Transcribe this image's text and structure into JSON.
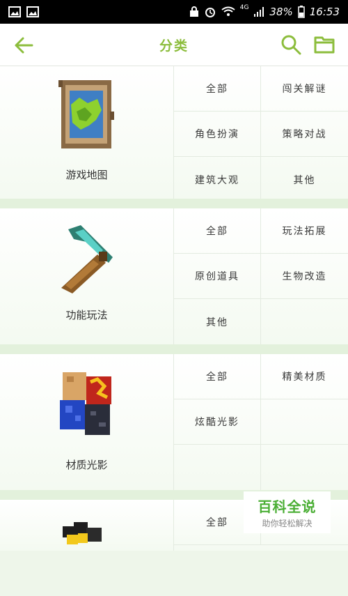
{
  "status_bar": {
    "network": "4G",
    "battery": "38%",
    "time": "16:53"
  },
  "app_bar": {
    "title": "分类"
  },
  "colors": {
    "accent": "#8cbd3c",
    "section_gap": "#e3f1dc"
  },
  "sections": [
    {
      "label": "游戏地图",
      "icon": "map-icon",
      "items": [
        "全部",
        "闯关解谜",
        "角色扮演",
        "策略对战",
        "建筑大观",
        "其他"
      ]
    },
    {
      "label": "功能玩法",
      "icon": "pickaxe-icon",
      "items": [
        "全部",
        "玩法拓展",
        "原创道具",
        "生物改造",
        "其他",
        ""
      ]
    },
    {
      "label": "材质光影",
      "icon": "texture-block-icon",
      "items": [
        "全部",
        "精美材质",
        "炫酷光影",
        "",
        "",
        ""
      ]
    },
    {
      "label": "",
      "icon": "bee-icon",
      "items": [
        "全部",
        ""
      ]
    }
  ],
  "watermark": {
    "title": "百科全说",
    "subtitle": "助你轻松解决"
  }
}
